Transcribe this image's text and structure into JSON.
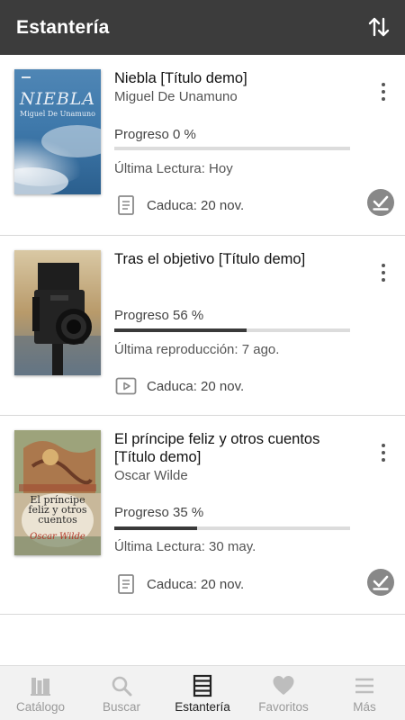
{
  "header": {
    "title": "Estantería",
    "sort_icon": "sort-arrows-icon"
  },
  "books": [
    {
      "title": "Niebla [Título demo]",
      "author": "Miguel De Unamuno",
      "progress_label": "Progreso 0 %",
      "progress": 0,
      "last_read": "Última Lectura: Hoy",
      "expiry": "Caduca: 20 nov.",
      "type_icon": "document-icon",
      "downloaded": true,
      "cover_text": {
        "title": "NIEBLA",
        "author": "Miguel De Unamuno"
      }
    },
    {
      "title": "Tras el objetivo [Título demo]",
      "author": "",
      "progress_label": "Progreso 56 %",
      "progress": 56,
      "last_read": "Última reproducción: 7 ago.",
      "expiry": "Caduca: 20 nov.",
      "type_icon": "video-play-icon",
      "downloaded": false
    },
    {
      "title": "El príncipe feliz y otros cuentos [Título demo]",
      "author": "Oscar Wilde",
      "progress_label": "Progreso 35 %",
      "progress": 35,
      "last_read": "Última Lectura: 30 may.",
      "expiry": "Caduca: 20 nov.",
      "type_icon": "document-icon",
      "downloaded": true,
      "cover_text": {
        "title": "El príncipe feliz y otros cuentos",
        "author": "Oscar Wilde"
      }
    }
  ],
  "nav": [
    {
      "label": "Catálogo",
      "icon": "catalog-icon",
      "active": false
    },
    {
      "label": "Buscar",
      "icon": "search-icon",
      "active": false
    },
    {
      "label": "Estantería",
      "icon": "shelf-icon",
      "active": true
    },
    {
      "label": "Favoritos",
      "icon": "heart-icon",
      "active": false
    },
    {
      "label": "Más",
      "icon": "menu-icon",
      "active": false
    }
  ],
  "colors": {
    "header_bg": "#3c3c3c",
    "progress_fill": "#3a3a3a",
    "progress_track": "#dcdcdc",
    "nav_bg": "#f2f2f2"
  }
}
